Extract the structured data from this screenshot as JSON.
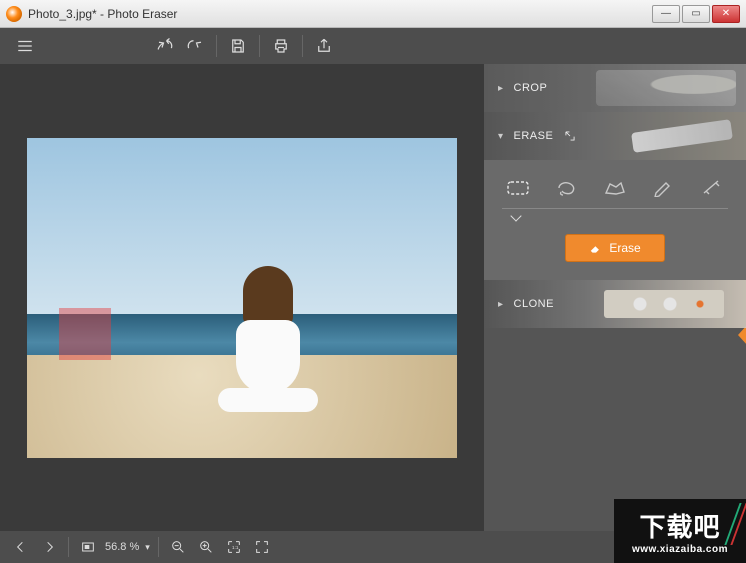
{
  "window": {
    "title": "Photo_3.jpg* - Photo Eraser"
  },
  "panels": {
    "crop": {
      "label": "CROP"
    },
    "erase": {
      "label": "ERASE",
      "button": "Erase"
    },
    "clone": {
      "label": "CLONE"
    }
  },
  "status": {
    "zoom": "56.8 %"
  },
  "watermark": {
    "text": "下载吧",
    "url": "www.xiazaiba.com"
  }
}
